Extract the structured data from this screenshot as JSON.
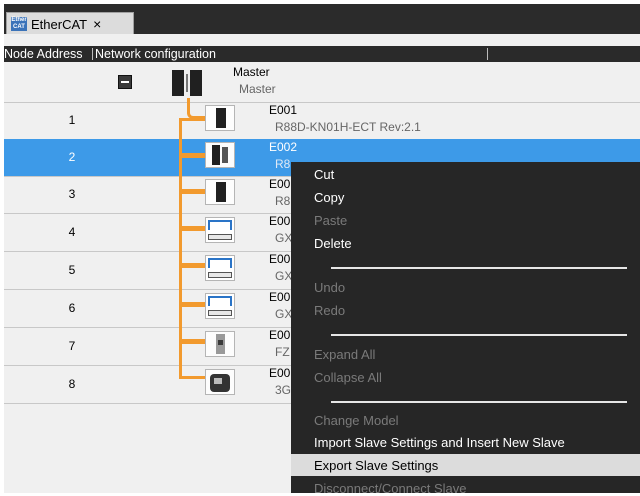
{
  "tab": {
    "label": "EtherCAT",
    "close": "×",
    "icon": "ethercat-icon"
  },
  "columns": {
    "node_address": "Node Address",
    "network_configuration": "Network configuration"
  },
  "master": {
    "name": "Master",
    "model": "Master"
  },
  "rows": [
    {
      "node": "1",
      "name": "E001",
      "model": "R88D-KN01H-ECT Rev:2.1",
      "icon": "servo-drive-icon"
    },
    {
      "node": "2",
      "name": "E002",
      "model": "R8",
      "icon": "servo-drive-icon",
      "selected": true
    },
    {
      "node": "3",
      "name": "E00",
      "model": "R8",
      "icon": "servo-drive-icon"
    },
    {
      "node": "4",
      "name": "E00",
      "model": "GX",
      "icon": "io-terminal-icon"
    },
    {
      "node": "5",
      "name": "E00",
      "model": "GX",
      "icon": "io-terminal-icon"
    },
    {
      "node": "6",
      "name": "E00",
      "model": "GX",
      "icon": "io-terminal-icon"
    },
    {
      "node": "7",
      "name": "E00",
      "model": "FZ",
      "icon": "vision-sensor-icon"
    },
    {
      "node": "8",
      "name": "E00",
      "model": "3G",
      "icon": "inverter-icon"
    }
  ],
  "context_menu": {
    "cut": "Cut",
    "copy": "Copy",
    "paste": "Paste",
    "delete": "Delete",
    "undo": "Undo",
    "redo": "Redo",
    "expand_all": "Expand All",
    "collapse_all": "Collapse All",
    "change_model": "Change Model",
    "import_slave": "Import Slave Settings and Insert New Slave",
    "export_slave": "Export Slave Settings",
    "disconnect_connect": "Disconnect/Connect Slave"
  },
  "colors": {
    "selection": "#3d9ae8",
    "wire": "#f29a2e",
    "menu_bg": "#262626",
    "menu_highlight": "#dcdcdc"
  }
}
